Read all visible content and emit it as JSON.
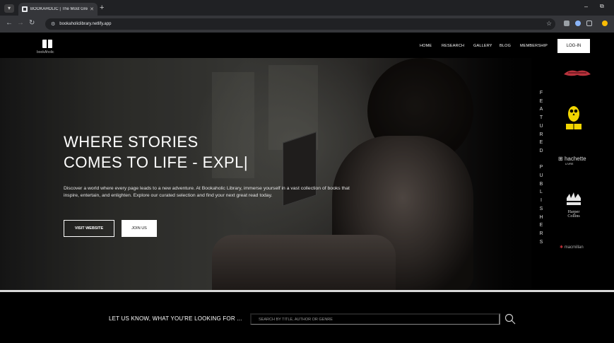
{
  "browser": {
    "tab_title": "BOOKAHOLIC | The Most Great",
    "url": "bookaholiclibrary.netlify.app"
  },
  "header": {
    "logo_text": "bookAholic",
    "menu": [
      "HOME",
      "RESEARCH",
      "GALLERY",
      "BLOG",
      "MEMBERSHIP"
    ],
    "login_label": "LOG-IN"
  },
  "hero": {
    "headline_line1": "WHERE STORIES",
    "headline_line2": "COMES TO LIFE - EXPL|",
    "description": "Discover a world where every page leads to a new adventure. At Bookaholic Library, immerse yourself in a vast collection of books that inspire, entertain, and enlighten. Explore our curated selection and find your next great read today.",
    "visit_label": "VISIT WEBSITE",
    "join_label": "JOIN US"
  },
  "featured": {
    "title_letters": [
      "F",
      "E",
      "A",
      "T",
      "U",
      "R",
      "E",
      "D",
      "",
      "P",
      "U",
      "B",
      "L",
      "I",
      "S",
      "H",
      "E",
      "R",
      "S"
    ],
    "hachette_name": "hachette",
    "hachette_sub": "LIVRE",
    "harper_line1": "Harper",
    "harper_line2": "Collins",
    "macmillan": "macmillan"
  },
  "search": {
    "prompt": "LET US KNOW, WHAT YOU'RE LOOKING FOR ...",
    "placeholder": "SEARCH BY TITLE, AUTHOR OR GENRE"
  },
  "colors": {
    "background": "#000000",
    "accent_yellow": "#f2d600",
    "penguin_red": "#c0303a"
  }
}
